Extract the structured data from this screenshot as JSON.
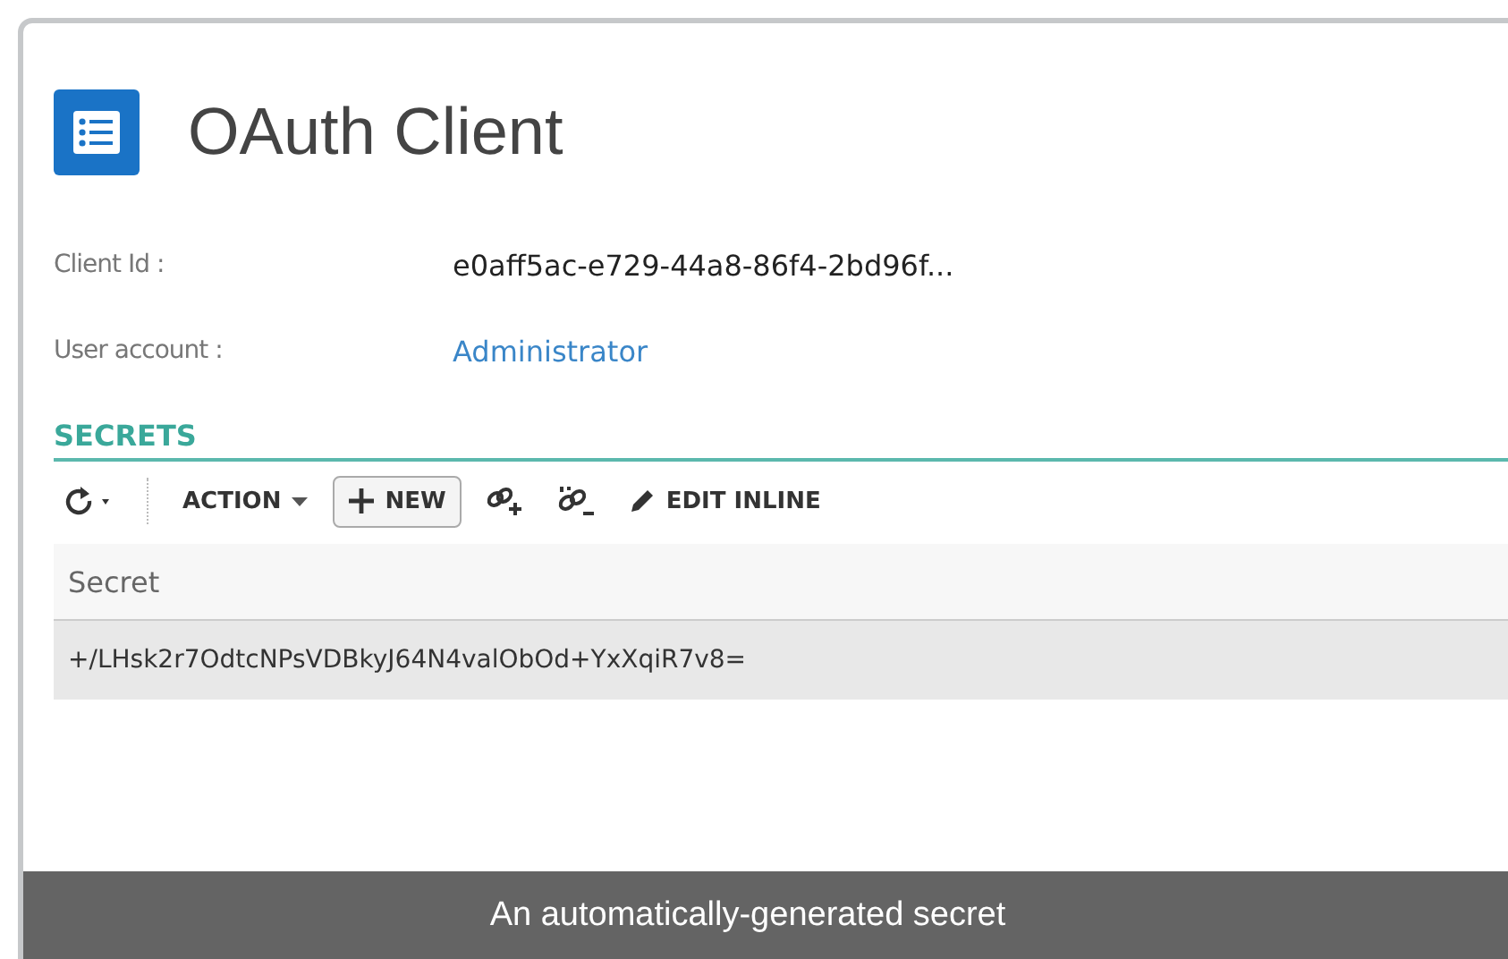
{
  "header": {
    "title": "OAuth Client"
  },
  "fields": [
    {
      "label": "Client Id :",
      "value": "e0aff5ac-e729-44a8-86f4-2bd96f...",
      "kind": "text"
    },
    {
      "label": "User account :",
      "value": "Administrator",
      "kind": "link"
    }
  ],
  "section": {
    "title": "SECRETS"
  },
  "toolbar": [
    {
      "kind": "refresh"
    },
    {
      "kind": "dropdown",
      "label": "ACTION"
    },
    {
      "kind": "new",
      "label": "NEW"
    },
    {
      "kind": "link"
    },
    {
      "kind": "unlink"
    },
    {
      "kind": "edit",
      "label": "EDIT INLINE"
    }
  ],
  "table": {
    "columns": [
      "Secret"
    ],
    "rows": [
      [
        "+/LHsk2r7OdtcNPsVDBkyJ64N4valObOd+YxXqiR7v8="
      ]
    ]
  },
  "caption": "An automatically-generated secret"
}
